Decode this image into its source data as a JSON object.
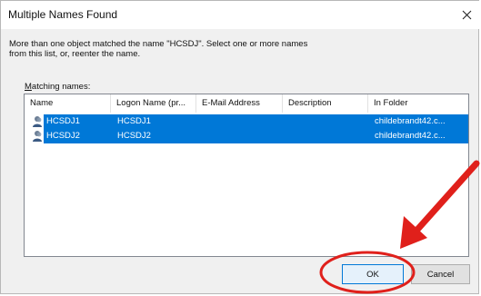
{
  "dialog": {
    "title": "Multiple Names Found",
    "message_line1": "More than one object matched the name \"HCSDJ\". Select one or more names",
    "message_line2": "from this list, or, reenter the name.",
    "list_label_accel": "M",
    "list_label_rest": "atching names:",
    "columns": [
      "Name",
      "Logon Name (pr...",
      "E-Mail Address",
      "Description",
      "In Folder"
    ],
    "rows": [
      {
        "name": "HCSDJ1",
        "logon": "HCSDJ1",
        "email": "",
        "description": "",
        "folder": "childebrandt42.c..."
      },
      {
        "name": "HCSDJ2",
        "logon": "HCSDJ2",
        "email": "",
        "description": "",
        "folder": "childebrandt42.c..."
      }
    ],
    "ok_label": "OK",
    "cancel_label": "Cancel"
  },
  "colors": {
    "selection": "#0078d7",
    "annotation": "#e0201b"
  },
  "icons": {
    "close": "close-icon",
    "user": "user-icon"
  }
}
